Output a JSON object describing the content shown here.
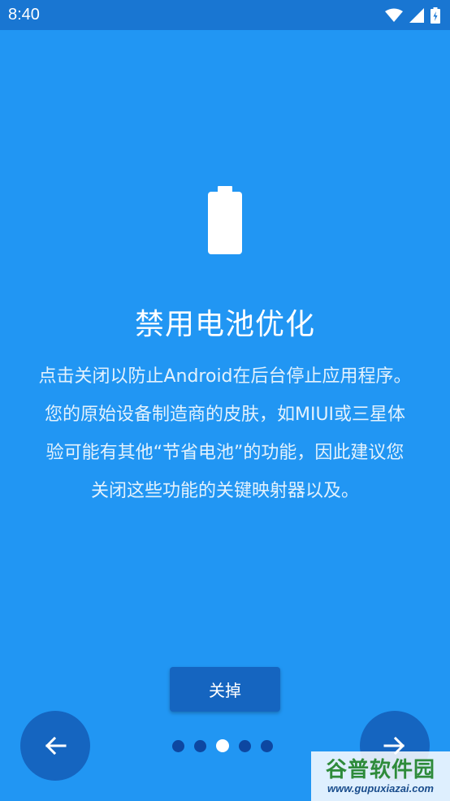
{
  "status_bar": {
    "time": "8:40",
    "icons": [
      "wifi-icon",
      "signal-icon",
      "battery-charging-icon"
    ]
  },
  "intro_slide": {
    "illustration": "battery-icon",
    "title": "禁用电池优化",
    "description_lines": [
      "点击关闭以防止Android在后台停止应用程序。",
      "您的原始设备制造商的皮肤，如MIUI或三星体",
      "验可能有其他“节省电池”的功能，因此建议您",
      "关闭这些功能的关键映射器以及。"
    ],
    "dismiss_label": "关掉"
  },
  "navigation": {
    "back_icon": "arrow-left-icon",
    "next_icon": "arrow-right-icon",
    "page_count": 5,
    "current_page": 3
  },
  "watermark": {
    "name": "谷普软件园",
    "url": "www.gupuxiazai.com"
  },
  "colors": {
    "background": "#2196F3",
    "status_bar": "#1976D2",
    "button": "#1565C0",
    "dot_inactive": "#0D47A1",
    "dot_active": "#FFFFFF"
  }
}
